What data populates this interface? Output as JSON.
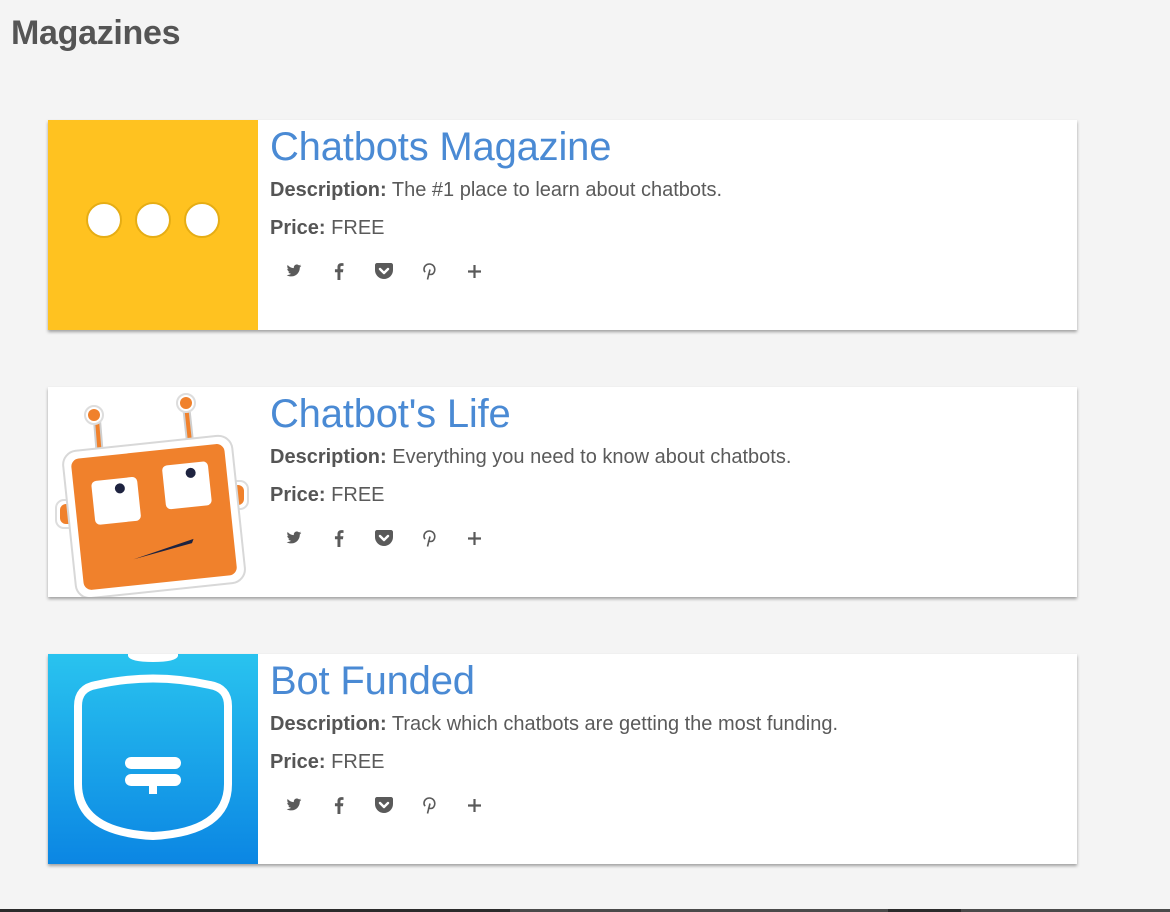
{
  "page": {
    "title": "Magazines"
  },
  "labels": {
    "description": "Description:",
    "price": "Price:"
  },
  "magazines": [
    {
      "title": "Chatbots Magazine",
      "description": "The #1 place to learn about chatbots.",
      "price": "FREE",
      "thumb_icon": "chat-dots-logo",
      "thumb_color": "#ffc220"
    },
    {
      "title": "Chatbot's Life",
      "description": "Everything you need to know about chatbots.",
      "price": "FREE",
      "thumb_icon": "orange-robot-logo",
      "thumb_color": "#f0812c"
    },
    {
      "title": "Bot Funded",
      "description": "Track which chatbots are getting the most funding.",
      "price": "FREE",
      "thumb_icon": "shield-logo",
      "thumb_color": "#1a9ae6"
    }
  ],
  "share_icons": [
    "twitter-icon",
    "facebook-icon",
    "pocket-icon",
    "pinterest-icon",
    "plus-icon"
  ],
  "colors": {
    "title": "#4a8ad4",
    "text": "#5a5a5a",
    "background": "#f4f4f4"
  }
}
